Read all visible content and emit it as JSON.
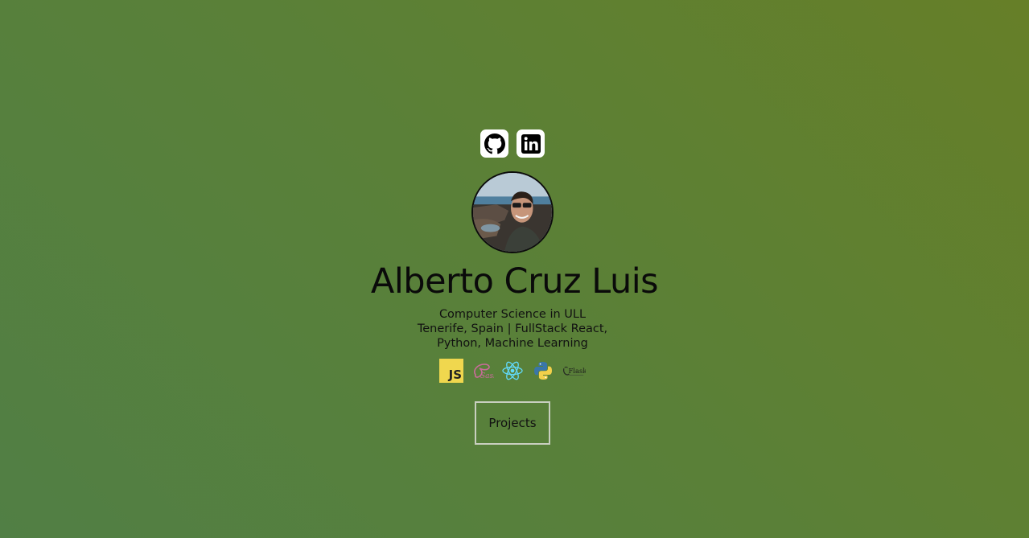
{
  "profile": {
    "name": "Alberto Cruz Luis",
    "bio_lines": [
      "Computer Science in ULL",
      "Tenerife, Spain | FullStack React,",
      "Python, Machine Learning"
    ]
  },
  "socials": [
    {
      "icon": "github-icon"
    },
    {
      "icon": "linkedin-icon"
    }
  ],
  "tech_stack": [
    {
      "icon": "javascript-icon",
      "label": "JS"
    },
    {
      "icon": "sass-icon",
      "label": "Sass"
    },
    {
      "icon": "react-icon"
    },
    {
      "icon": "python-icon"
    },
    {
      "icon": "flask-icon",
      "label": "Flask"
    }
  ],
  "actions": {
    "projects_label": "Projects"
  },
  "colors": {
    "background_start": "#517f45",
    "background_end": "#667f28",
    "js_yellow": "#f0d74e",
    "sass_pink": "#c96b9a",
    "react_cyan": "#61dafb",
    "python_blue": "#3a76a8",
    "python_yellow": "#f2d04b"
  }
}
